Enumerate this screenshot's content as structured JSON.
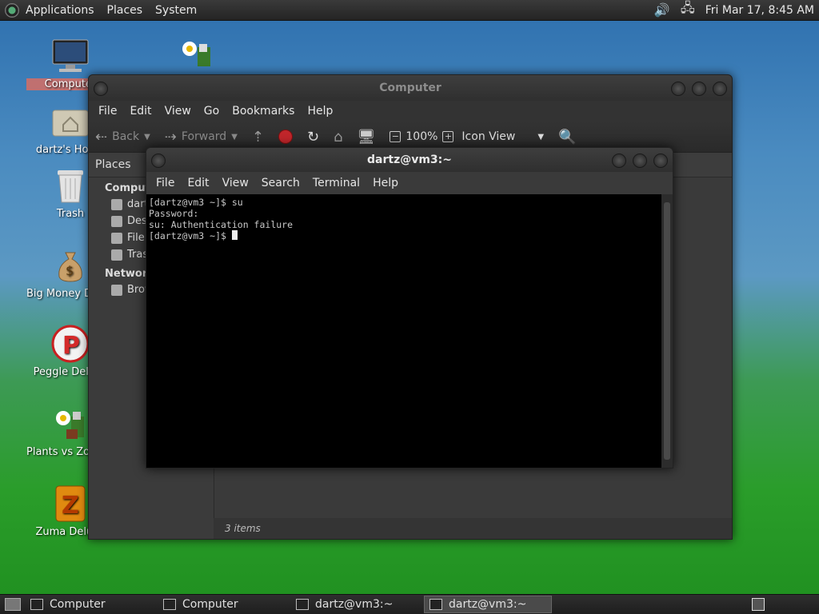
{
  "top_panel": {
    "menus": [
      "Applications",
      "Places",
      "System"
    ],
    "clock": "Fri Mar 17,  8:45 AM",
    "icons": [
      "gnome-foot-icon",
      "volume-icon",
      "network-icon"
    ]
  },
  "desktop_icons": [
    {
      "label": "Computer",
      "icon": "computer-icon"
    },
    {
      "label": "dartz's Home",
      "icon": "home-folder-icon"
    },
    {
      "label": "Trash",
      "icon": "trash-icon"
    },
    {
      "label": "Big Money Deluxe",
      "icon": "money-bag-icon"
    },
    {
      "label": "Peggle Deluxe",
      "icon": "peggle-icon"
    },
    {
      "label": "Plants vs Zombies",
      "icon": "plants-icon"
    },
    {
      "label": "Zuma Deluxe",
      "icon": "zuma-icon"
    }
  ],
  "nautilus": {
    "title": "Computer",
    "menu": [
      "File",
      "Edit",
      "View",
      "Go",
      "Bookmarks",
      "Help"
    ],
    "toolbar": {
      "back": "Back",
      "forward": "Forward",
      "zoom": "100%",
      "view_mode": "Icon View"
    },
    "places_label": "Places",
    "sidebar": {
      "computer_header": "Computer",
      "items": [
        "dartz",
        "Desktop",
        "File System",
        "Trash"
      ],
      "network_header": "Network",
      "network_items": [
        "Browse Network"
      ]
    },
    "status": "3 items"
  },
  "terminal": {
    "title": "dartz@vm3:~",
    "menu": [
      "File",
      "Edit",
      "View",
      "Search",
      "Terminal",
      "Help"
    ],
    "lines": [
      "[dartz@vm3 ~]$ su",
      "Password:",
      "su: Authentication failure",
      "[dartz@vm3 ~]$ "
    ]
  },
  "taskbar": [
    {
      "label": "Computer",
      "active": false
    },
    {
      "label": "Computer",
      "active": false
    },
    {
      "label": "dartz@vm3:~",
      "active": false
    },
    {
      "label": "dartz@vm3:~",
      "active": true
    }
  ]
}
